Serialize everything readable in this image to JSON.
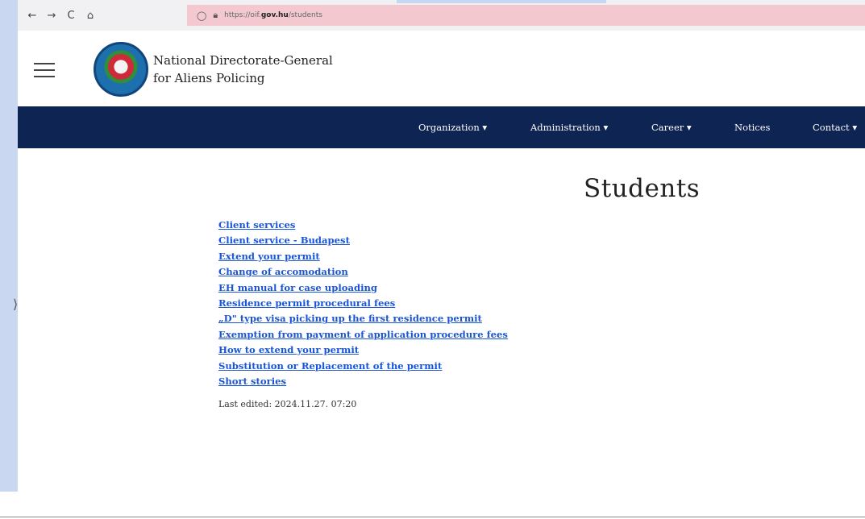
{
  "browser": {
    "back_icon": "←",
    "forward_icon": "→",
    "reload_icon": "C",
    "home_icon": "⌂",
    "url_prefix": "https://oif.",
    "url_host": "gov.hu",
    "url_path": "/students"
  },
  "header": {
    "title_line1": "National Directorate-General",
    "title_line2": "for Aliens Policing"
  },
  "nav": {
    "items": [
      {
        "label": "Organization ▾"
      },
      {
        "label": "Administration ▾"
      },
      {
        "label": "Career ▾"
      },
      {
        "label": "Notices"
      },
      {
        "label": "Contact ▾"
      }
    ]
  },
  "main": {
    "title": "Students",
    "links": [
      "Client services",
      "Client service - Budapest",
      "Extend your permit",
      "Change of accomodation",
      "EH manual for case uploading",
      "Residence permit procedural fees",
      "„D\" type visa picking up the first residence permit",
      "Exemption from payment of application procedure fees",
      "How to extend your permit",
      "Substitution or Replacement of the permit",
      "Short stories"
    ],
    "last_edited": "Last edited: 2024.11.27. 07:20"
  },
  "colors": {
    "nav_bg": "#0e2453",
    "link": "#1a55d8",
    "url_bar": "#f3c9cf"
  }
}
